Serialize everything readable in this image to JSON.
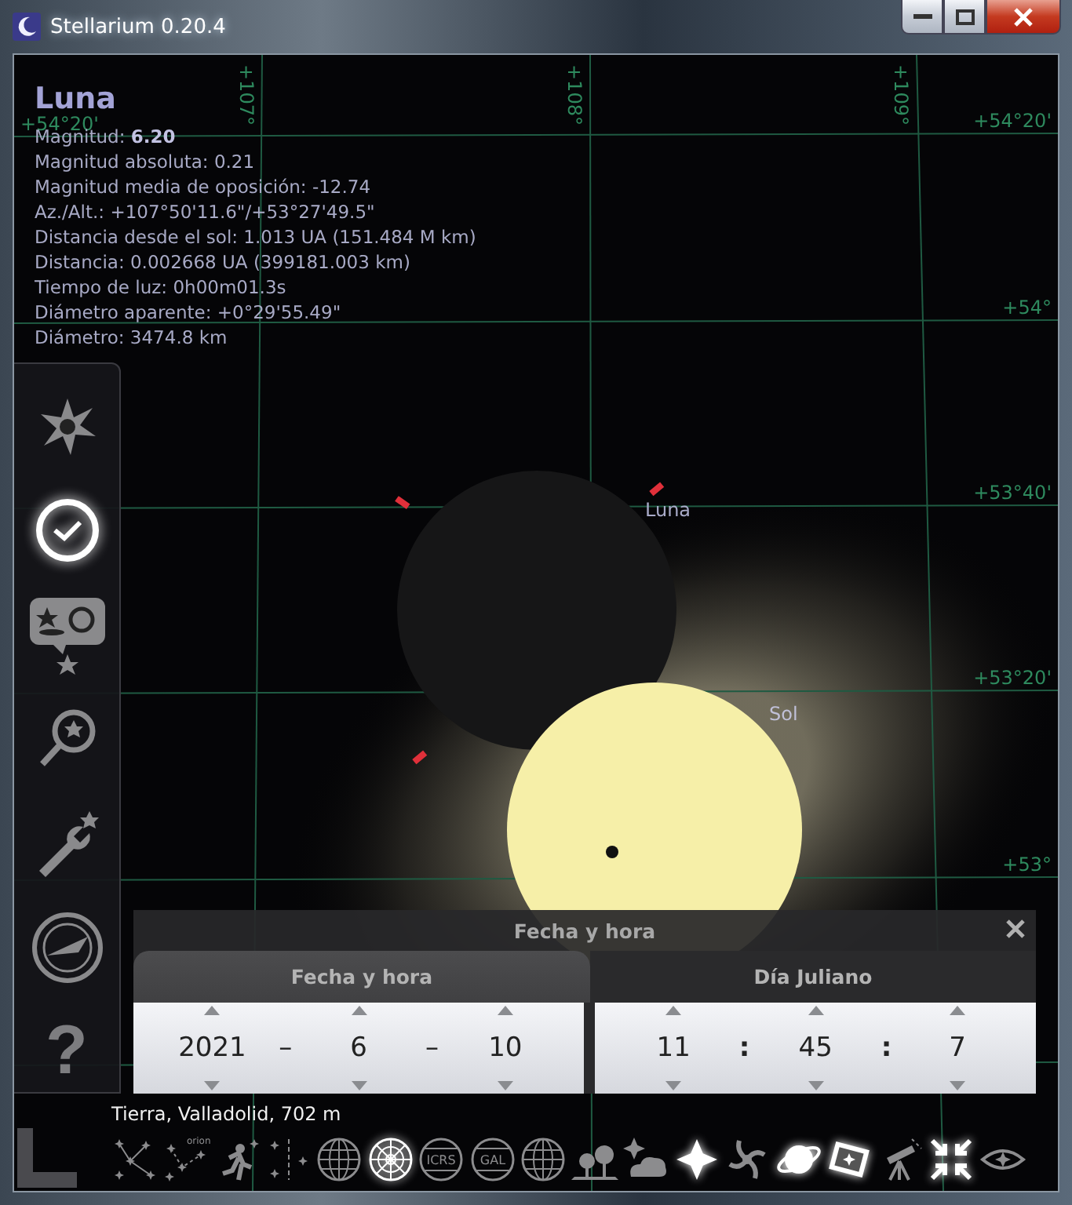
{
  "window": {
    "title": "Stellarium 0.20.4"
  },
  "info": {
    "name": "Luna",
    "lines": [
      "Magnitud: **6.20**",
      "Magnitud absoluta: 0.21",
      "Magnitud media de oposición: -12.74",
      "Az./Alt.: +107°50'11.6\"/+53°27'49.5\"",
      "Distancia desde el sol: 1.013 UA (151.484 M km)",
      "Distancia: 0.002668 UA (399181.003 km)",
      "Tiempo de luz: 0h00m01.3s",
      "Diámetro aparente: +0°29'55.49\"",
      "Diámetro: 3474.8 km"
    ]
  },
  "grid": {
    "parallels": [
      {
        "left": "+54°20'",
        "right": "+54°20'"
      },
      {
        "right": "+54°"
      },
      {
        "right": "+53°40'"
      },
      {
        "right": "+53°20'"
      },
      {
        "right": "+53°"
      }
    ],
    "meridians": [
      {
        "top": "+107°"
      },
      {
        "top": "+108°"
      },
      {
        "top": "+109°"
      }
    ]
  },
  "objects": [
    {
      "kind": "moon",
      "label": "Luna"
    },
    {
      "kind": "sun",
      "label": "Sol"
    }
  ],
  "sidebar": [
    {
      "kind": "sun",
      "selected": false
    },
    {
      "kind": "clock",
      "selected": true
    },
    {
      "kind": "objects",
      "selected": false
    },
    {
      "kind": "search",
      "selected": false
    },
    {
      "kind": "settings",
      "selected": false
    },
    {
      "kind": "dial",
      "selected": false
    },
    {
      "kind": "help",
      "label": "?",
      "selected": false
    }
  ],
  "dialog": {
    "title": "Fecha y hora",
    "tabs": [
      {
        "label": "Fecha y hora",
        "selected": true
      },
      {
        "label": "Día Juliano",
        "selected": false
      }
    ],
    "groups": [
      {
        "kind": "date",
        "values": [
          "2021",
          "6",
          "10"
        ],
        "separators": [
          "–",
          "–"
        ]
      },
      {
        "kind": "time",
        "values": [
          "11",
          "45",
          "7"
        ],
        "separators": [
          ":",
          ":"
        ]
      }
    ]
  },
  "status": {
    "location": "Tierra, Valladolid, 702 m"
  },
  "toolbar": [
    {
      "kind": "lines",
      "selected": false
    },
    {
      "kind": "labels",
      "label": "orion",
      "selected": false
    },
    {
      "kind": "art",
      "selected": false
    },
    {
      "kind": "boundaries",
      "selected": false
    },
    {
      "kind": "globe",
      "selected": false
    },
    {
      "kind": "polar",
      "selected": true
    },
    {
      "kind": "tagged",
      "label": "ICRS",
      "selected": false
    },
    {
      "kind": "tagged",
      "label": "GAL",
      "selected": false
    },
    {
      "kind": "globe2",
      "selected": false
    },
    {
      "kind": "ground",
      "selected": false
    },
    {
      "kind": "cloud",
      "selected": false
    },
    {
      "kind": "star",
      "selected": true
    },
    {
      "kind": "spiral",
      "selected": false
    },
    {
      "kind": "planet",
      "selected": true
    },
    {
      "kind": "images",
      "selected": true
    },
    {
      "kind": "telescope",
      "selected": false
    },
    {
      "kind": "fullscreen",
      "selected": true
    },
    {
      "kind": "eye",
      "selected": false
    }
  ]
}
